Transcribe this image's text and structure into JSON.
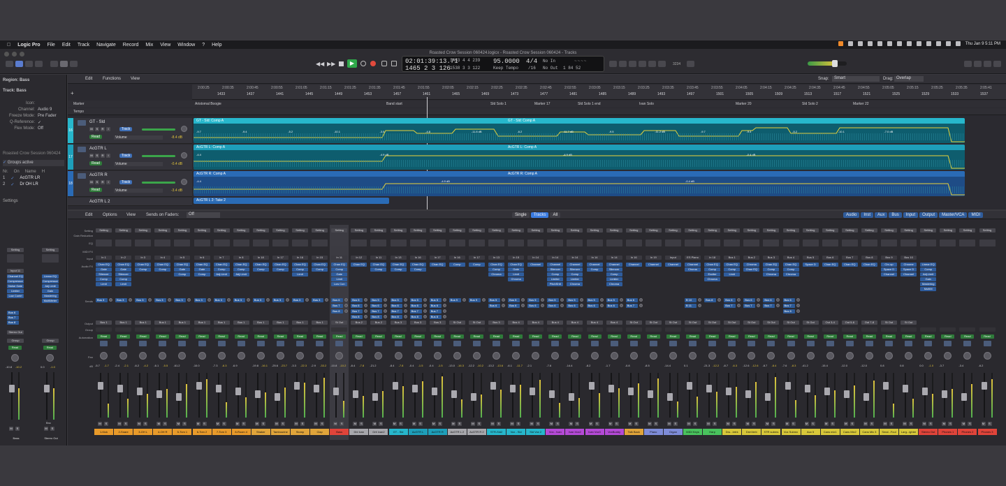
{
  "menubar": {
    "app": "Logic Pro",
    "items": [
      "File",
      "Edit",
      "Track",
      "Navigate",
      "Record",
      "Mix",
      "View",
      "Window",
      "?",
      "Help"
    ],
    "clock": "Thu Jan 9  5:11 PM"
  },
  "window_title": "Roasted Crow Session 060424.logicx - Roasted Crow Session 060424 - Tracks",
  "lcd": {
    "time": "02:01:39:13.71",
    "bars": "1465  2  3  126",
    "sub_time": "1433  4  4  239",
    "sub_bars": "1538  3  3  122",
    "tempo": "95.0000",
    "tempo_mode": "Keep Tempo",
    "signature": "4/4",
    "division": "/16",
    "in_label": "No In",
    "out_label": "No Out",
    "cpu": "1 84 52",
    "counter": "3234"
  },
  "inspector": {
    "region": "Region: Bass",
    "track": "Track: Bass",
    "rows": [
      {
        "k": "Icon:",
        "v": ""
      },
      {
        "k": "Channel:",
        "v": "Audio 9"
      },
      {
        "k": "Freeze Mode:",
        "v": "Pre Fader"
      },
      {
        "k": "Q-Reference:",
        "v": "✓"
      },
      {
        "k": "Flex Mode:",
        "v": "Off"
      }
    ],
    "session_label": "Roasted Crow Session 060424",
    "groups_active": "Groups active",
    "groups_head": [
      "Nr.",
      "On",
      "Name",
      "H"
    ],
    "groups": [
      {
        "nr": "1",
        "name": "AcGTR LR"
      },
      {
        "nr": "2",
        "name": "Dr OH LR"
      }
    ],
    "settings": "Settings",
    "strip1": {
      "setting": "Setting",
      "input": "Input 11",
      "plugins": [
        "Channel EQ",
        "Compressor",
        "Noise Gate",
        "Limiter",
        "Low Contrl"
      ],
      "sends": [
        "Bus 6",
        "Bus 7",
        "Bus 8"
      ],
      "output": "Stereo Out",
      "group": "Group",
      "auto": "Read",
      "db_left": "-10.8",
      "db_right": "-10.2",
      "name": "Bass"
    },
    "strip2": {
      "setting": "Setting",
      "plugins": [
        "Linear EQ",
        "Compressor",
        "Adj.Limit",
        "Gain",
        "Mastering",
        "MultiMeter"
      ],
      "group": "Group",
      "auto": "Read",
      "db_left": "0.0",
      "db_right": "-1.0",
      "bnc": "Bnc",
      "name": "Stereo Out"
    }
  },
  "tracks_toolbar": {
    "edit": "Edit",
    "functions": "Functions",
    "view": "View",
    "snap_label": "Snap:",
    "snap": "Smart",
    "drag_label": "Drag:",
    "drag": "Overlap"
  },
  "ruler": {
    "times": [
      "2:00:25",
      "2:00:35",
      "2:00:45",
      "2:00:55",
      "2:01:05",
      "2:01:15",
      "2:01:25",
      "2:01:35",
      "2:01:45",
      "2:01:55",
      "2:02:05",
      "2:02:15",
      "2:02:25",
      "2:02:35",
      "2:02:45",
      "2:02:55",
      "2:03:05",
      "2:03:15",
      "2:03:25",
      "2:03:35",
      "2:03:45",
      "2:03:55",
      "2:04:05",
      "2:04:15",
      "2:04:25",
      "2:04:35",
      "2:04:45",
      "2:04:55",
      "2:05:05",
      "2:05:15",
      "2:05:25",
      "2:05:35",
      "2:05:41"
    ],
    "bars": [
      "1433",
      "1437",
      "1441",
      "1445",
      "1449",
      "1453",
      "1457",
      "1461",
      "1465",
      "1469",
      "1473",
      "1477",
      "1481",
      "1485",
      "1489",
      "1493",
      "1497",
      "1501",
      "1505",
      "1509",
      "1513",
      "1517",
      "1521",
      "1525",
      "1529",
      "1533",
      "1537"
    ]
  },
  "marker_label": "Marker",
  "tempo_label": "Tempo",
  "markers": [
    "Aristomal Boogie",
    "Band start",
    "Sld Solo 1",
    "Marker 17",
    "Sld Solo 1 end",
    "Ivan Solo",
    "Marker 20",
    "Sld Solo 2",
    "Marker 22"
  ],
  "tracks": [
    {
      "num": "16",
      "name": "GT - Sld",
      "mode": "Read",
      "param": "Volume",
      "db": "-8.4 dB",
      "region": "GT - Sld: Comp A",
      "region2": "GT - Sld: Comp A",
      "color": "#27b7cc"
    },
    {
      "num": "17",
      "name": "AcGTR L",
      "mode": "Read",
      "param": "Volume",
      "db": "-0.4 dB",
      "region": "AcGTR L: Comp A",
      "region2": "AcGTR L: Comp A",
      "color": "#1e9fba"
    },
    {
      "num": "18",
      "name": "AcGTR R",
      "mode": "Read",
      "param": "Volume",
      "db": "-3.4 dB",
      "region": "AcGTR R: Comp A",
      "region2": "AcGTR R: Comp A",
      "color": "#2a6bb6"
    },
    {
      "num": "19",
      "name": "AcGTR L 2",
      "region": "AcGTR L 2: Take 2"
    }
  ],
  "automation_values": [
    [
      "-9.7",
      "-9.4",
      "-5.2",
      "-10.1",
      "-3.5",
      "-4.8",
      "-11.8 dB",
      "-6.2",
      "-11.7 dB",
      "-9.5",
      "-11.2 dB",
      "-9.7",
      "-9.4",
      "-5.2",
      "-10.1",
      "-7.0 dB"
    ],
    [
      "-4.4",
      "-4.9 dB",
      "-4.9 dB",
      "-0.4 dB"
    ],
    [
      "-4.4",
      "-4.9 dB",
      "-0.4 dB"
    ]
  ],
  "mixer_toolbar": {
    "edit": "Edit",
    "options": "Options",
    "view": "View",
    "sends_on_faders": "Sends on Faders:",
    "sends_value": "Off",
    "filter": [
      "Single",
      "Tracks",
      "All"
    ],
    "types": [
      "Audio",
      "Inst",
      "Aux",
      "Bus",
      "Input",
      "Output",
      "Master/VCA",
      "MIDI"
    ]
  },
  "row_labels": [
    "Setting",
    "Gain Reduction",
    "EQ",
    "MIDI FX",
    "Input",
    "Audio FX",
    "Sends",
    "Output",
    "Group",
    "Automation",
    "Pan",
    "dB"
  ],
  "strips": [
    {
      "name": "1-Kick",
      "color": "#e89a2a",
      "input": "In 1",
      "fx": [
        "Chan EQ",
        "Gate",
        "Silencer",
        "Comp",
        "Limit"
      ],
      "sends": [
        "Bus 3"
      ],
      "out": "Bus 1",
      "db": "-5.7",
      "db2": "-1.7",
      "auto": "Read"
    },
    {
      "name": "2-Snare",
      "color": "#e89a2a",
      "input": "In 2",
      "fx": [
        "Chan EQ",
        "Gate",
        "Silencer",
        "Comp",
        "Limit"
      ],
      "sends": [
        "Bus 3"
      ],
      "out": "Bus 1",
      "db": "-2.4",
      "db2": "-2.1",
      "auto": "Read"
    },
    {
      "name": "3-OH L",
      "color": "#e89a2a",
      "input": "In 3",
      "fx": [
        "Chan EQ",
        "Comp"
      ],
      "sends": [
        "Bus 3"
      ],
      "out": "Bus 1",
      "db": "-6.2",
      "db2": "-4.2",
      "auto": "Read"
    },
    {
      "name": "4-OH R",
      "color": "#e89a2a",
      "input": "In 4",
      "fx": [
        "Chan EQ",
        "Comp"
      ],
      "sends": [
        "Bus 3"
      ],
      "out": "Bus 1",
      "db": "-6.1",
      "db2": "-5.5",
      "auto": "Read"
    },
    {
      "name": "5-Tom 1",
      "color": "#e89a2a",
      "input": "In 5",
      "fx": [
        "Chan EQ",
        "Gate",
        "Comp"
      ],
      "sends": [
        "Bus 3"
      ],
      "out": "Bus 1",
      "db": "-61.2",
      "db2": "",
      "auto": "Read"
    },
    {
      "name": "6-Tom 2",
      "color": "#e89a2a",
      "input": "In 6",
      "fx": [
        "Chan EQ",
        "Gate",
        "Comp"
      ],
      "sends": [
        "Bus 3"
      ],
      "out": "Bus 1",
      "db": "-10.0",
      "db2": "",
      "auto": "Read"
    },
    {
      "name": "7-Tom 3",
      "color": "#e89a2a",
      "input": "In 7",
      "fx": [
        "Chan EQ",
        "Comp",
        "Adj.Limit"
      ],
      "sends": [
        "Bus 3"
      ],
      "out": "Bus 1",
      "db": "-7.3",
      "db2": "-6.3",
      "auto": "Read"
    },
    {
      "name": "8-Room 4",
      "color": "#e89a2a",
      "input": "In 8",
      "fx": [
        "Chan EQ",
        "Comp",
        "Adj.Limit"
      ],
      "sends": [
        "Bus 3"
      ],
      "out": "Bus 1",
      "db": "-6.9",
      "db2": "",
      "auto": "Read"
    },
    {
      "name": "Shaker",
      "color": "#e0a43a",
      "input": "In 18",
      "fx": [
        "Chan EQ",
        "Comp"
      ],
      "sends": [
        "Bus 3"
      ],
      "out": "Bus 1",
      "db": "-19.8",
      "db2": "-16.1",
      "auto": "Read"
    },
    {
      "name": "Tambourine",
      "color": "#e0a43a",
      "input": "In 17",
      "fx": [
        "Chan EQ",
        "Comp"
      ],
      "sends": [
        "Bus 3"
      ],
      "out": "Bus 1",
      "db": "-25.6",
      "db2": "-23.7",
      "auto": "Read"
    },
    {
      "name": "Stomp",
      "color": "#e0a43a",
      "input": "In 16",
      "fx": [
        "Chan EQ",
        "Comp",
        "Limit"
      ],
      "sends": [
        "Bus 3"
      ],
      "out": "Bus 1",
      "db": "-3.3",
      "db2": "-22.3",
      "auto": "Read"
    },
    {
      "name": "Clap",
      "color": "#e0a43a",
      "input": "In 15",
      "fx": [
        "Chan EQ",
        "Comp"
      ],
      "sends": [
        "Bus 3"
      ],
      "out": "Bus 1",
      "db": "-2.9",
      "db2": "-33.2",
      "auto": "Read"
    },
    {
      "name": "Bass",
      "color": "#e0443a",
      "input": "In 11",
      "fx": [
        "Chan EQ",
        "Comp",
        "Gate",
        "Limit",
        "Low Con"
      ],
      "sends": [
        "Bus 6",
        "Bus 7",
        "Bus 8"
      ],
      "out": "St Out",
      "db": "-10.8",
      "db2": "-10.2",
      "auto": "Read"
    },
    {
      "name": "Dbl Ivan",
      "color": "#a7a7ac",
      "input": "In 12",
      "fx": [
        "Chan EQ"
      ],
      "sends": [
        "Bus 5",
        "Bus 6",
        "Bus 7",
        "Bus 8"
      ],
      "out": "Bus 2",
      "db": "-8.4",
      "db2": "-7.8",
      "auto": "Read"
    },
    {
      "name": "Grit Ivan2",
      "color": "#a7a7ac",
      "input": "In 11",
      "fx": [
        "Chan EQ",
        "Comp"
      ],
      "sends": [
        "Bus 5",
        "Bus 6",
        "Bus 7",
        "Bus 8"
      ],
      "out": "Bus 2",
      "db": "-21.2",
      "db2": "",
      "auto": "Read"
    },
    {
      "name": "GT - Sld",
      "color": "#27b7cc",
      "input": "In 13",
      "fx": [
        "Chan EQ",
        "Comp"
      ],
      "sends": [
        "Bus 5",
        "Bus 6",
        "Bus 7",
        "Bus 8"
      ],
      "out": "Bus 3",
      "db": "-8.4",
      "db2": "-7.8",
      "auto": "Read"
    },
    {
      "name": "AcGTR L",
      "color": "#1e9fba",
      "input": "In 16",
      "fx": [
        "Chan EQ",
        "Comp"
      ],
      "sends": [
        "Bus 5",
        "Bus 6",
        "Bus 7",
        "Bus 8"
      ],
      "out": "Bus 3",
      "db": "-0.4",
      "db2": "-1.5",
      "auto": "Read"
    },
    {
      "name": "AcGTR R",
      "color": "#1e9fba",
      "input": "In 17",
      "fx": [
        "Chan EQ"
      ],
      "sends": [
        "Bus 5",
        "Bus 6",
        "Bus 7",
        "Bus 8"
      ],
      "out": "Bus 3",
      "db": "-0.4",
      "db2": "-1.5",
      "auto": "Read"
    },
    {
      "name": "AcGTR L 2",
      "color": "#a7a7ac",
      "input": "In 16",
      "fx": [
        "Comp"
      ],
      "sends": [
        "Bus 9"
      ],
      "out": "St Out",
      "db": "-13.0",
      "db2": "-16.3",
      "auto": "Read"
    },
    {
      "name": "AcGTR R 2",
      "color": "#a7a7ac",
      "input": "In 17",
      "fx": [
        "Comp"
      ],
      "sends": [
        "Bus 9"
      ],
      "out": "St Out",
      "db": "-12.2",
      "db2": "-10.2",
      "auto": "Read"
    },
    {
      "name": "STR-Sld2",
      "color": "#27b7cc",
      "input": "In 13",
      "fx": [
        "Chan EQ",
        "Comp",
        "Chroma"
      ],
      "sends": [
        "Bus 5",
        "Bus 6"
      ],
      "out": "Bus 3",
      "db": "-13.2",
      "db2": "-13.6",
      "auto": "Read"
    },
    {
      "name": "Vox - Sld",
      "color": "#27b7cc",
      "input": "In 15",
      "fx": [
        "Chan EQ",
        "Gate",
        "Limit",
        "Chroma"
      ],
      "sends": [
        "Bus 5",
        "Bus 6"
      ],
      "out": "Bus 4",
      "db": "-6.1",
      "db2": "-11.7",
      "auto": "Read"
    },
    {
      "name": "Sld Vox 2",
      "color": "#27b7cc",
      "input": "In 14",
      "fx": [
        "Channel"
      ],
      "sends": [
        "Bus 5",
        "Bus 6"
      ],
      "out": "Bus 4",
      "db": "-2.1",
      "db2": "",
      "auto": "Read"
    },
    {
      "name": "Vox - Ivan",
      "color": "#b44ad6",
      "input": "In 14",
      "fx": [
        "Channel",
        "Silencer",
        "Comp",
        "Limiter",
        "PitchShft"
      ],
      "sends": [
        "Bus 5",
        "Bus 6"
      ],
      "out": "Bus 4",
      "db": "-7.6",
      "db2": "",
      "auto": "Read"
    },
    {
      "name": "Ivan Vox2",
      "color": "#b44ad6",
      "input": "In 14",
      "fx": [
        "Channel",
        "Silencer",
        "Comp",
        "Limiter",
        "Chroma"
      ],
      "sends": [
        "Bus 5",
        "Bus 6"
      ],
      "out": "Bus 4",
      "db": "-14.4",
      "db2": "",
      "auto": "Read"
    },
    {
      "name": "Ivan Vox3",
      "color": "#b44ad6",
      "input": "In 14",
      "fx": [
        "Channel",
        "Comp"
      ],
      "sends": [
        "Bus 5",
        "Bus 6"
      ],
      "out": "Bus 4",
      "db": "-8.2",
      "db2": "",
      "auto": "Read"
    },
    {
      "name": "VoxBuddy",
      "color": "#b44ad6",
      "input": "In 14",
      "fx": [
        "Channel",
        "Silencer",
        "Comp",
        "Limiter",
        "Chroma"
      ],
      "sends": [
        "Bus 5",
        "Bus 6"
      ],
      "out": "Bus 4",
      "db": "-1.7",
      "db2": "",
      "auto": "Read"
    },
    {
      "name": "Talk Back",
      "color": "#e0a43a",
      "input": "In 16",
      "fx": [
        "Channel"
      ],
      "sends": [
        "Bus 6",
        "Bus 7"
      ],
      "out": "St Out",
      "db": "-0.8",
      "db2": "",
      "auto": "Read"
    },
    {
      "name": "Piano",
      "color": "#7e8cd8",
      "input": "In 19",
      "fx": [
        "Channel"
      ],
      "sends": [],
      "out": "St Out",
      "db": "-8.5",
      "db2": "",
      "auto": "Read"
    },
    {
      "name": "Organ",
      "color": "#7e8cd8",
      "input": "Input",
      "fx": [
        "Channel"
      ],
      "sends": [],
      "out": "St Out",
      "db": "-14.4",
      "db2": "",
      "auto": "Read"
    },
    {
      "name": "MIDI Keys",
      "color": "#49c25d",
      "input": "ES Piano",
      "fx": [
        "Channel",
        "Chorus"
      ],
      "sends": [
        "B 10",
        "B 11"
      ],
      "out": "St Out",
      "db": "0.1",
      "db2": "",
      "auto": "Read"
    },
    {
      "name": "Harp",
      "color": "#49c25d",
      "input": "In 18",
      "fx": [
        "Chan EQ",
        "Comp",
        "Exciter",
        "Chroma"
      ],
      "sends": [
        "Bus 8"
      ],
      "out": "St Out",
      "db": "-21.3",
      "db2": "-12.2",
      "auto": "Read"
    },
    {
      "name": "Dru...brtrk",
      "color": "#d8c83a",
      "input": "Bus 1",
      "fx": [
        "Chan EQ",
        "Comp",
        "Limit"
      ],
      "sends": [
        "Bus 6",
        "Bus 7"
      ],
      "out": "St Out",
      "db": "-8.7",
      "db2": "-6.3",
      "auto": "Read"
    },
    {
      "name": "DrmVerb",
      "color": "#d8c83a",
      "input": "Bus 2",
      "fx": [
        "Chroma",
        "Chan EQ"
      ],
      "sends": [
        "Bus 6",
        "Bus 7"
      ],
      "out": "St Out",
      "db": "-12.6",
      "db2": "-12.6",
      "auto": "Read"
    },
    {
      "name": "STR subms",
      "color": "#d8c83a",
      "input": "Bus 3",
      "fx": [
        "Chan EQ",
        "Comp",
        "Chroma"
      ],
      "sends": [
        "Bus 6",
        "Bus 7"
      ],
      "out": "St Out",
      "db": "-8.7",
      "db2": "-8.4",
      "auto": "Read"
    },
    {
      "name": "Vox Submx",
      "color": "#d8c83a",
      "input": "Bus 4",
      "fx": [
        "Chan EQ",
        "Comp",
        "Chroma"
      ],
      "sends": [
        "Bus 6",
        "Bus 7",
        "Bus 8"
      ],
      "out": "St Out",
      "db": "-7.6",
      "db2": "-8.3",
      "auto": "Read"
    },
    {
      "name": "Aux 5",
      "color": "#d8c83a",
      "input": "Bus 5",
      "fx": [
        "Space D"
      ],
      "sends": [],
      "out": "St Out",
      "db": "-41.2",
      "db2": "",
      "auto": "Read"
    },
    {
      "name": "Cans mix1",
      "color": "#d8c83a",
      "input": "Bus 6",
      "fx": [
        "Chan EQ"
      ],
      "sends": [],
      "out": "Out 3-4",
      "db": "-15.4",
      "db2": "",
      "auto": "Read"
    },
    {
      "name": "Cans Mix2",
      "color": "#d8c83a",
      "input": "Bus 7",
      "fx": [
        "Chan EQ"
      ],
      "sends": [],
      "out": "Out 5-6",
      "db": "-12.0",
      "db2": "",
      "auto": "Read"
    },
    {
      "name": "Cans Mix 3",
      "color": "#d8c83a",
      "input": "Bus 8",
      "fx": [
        "Chan EQ"
      ],
      "sends": [],
      "out": "Out 7-8",
      "db": "-12.0",
      "db2": "",
      "auto": "Read"
    },
    {
      "name": "Smal...Foul",
      "color": "#d8c83a",
      "input": "Bus 9",
      "fx": [
        "Chr-op",
        "Space D",
        "Channel"
      ],
      "sends": [],
      "out": "St Out",
      "db": "0.8",
      "db2": "",
      "auto": "Read"
    },
    {
      "name": "Larg...ighter",
      "color": "#d8c83a",
      "input": "Bus 10",
      "fx": [
        "Chrome",
        "Space D",
        "Channel"
      ],
      "sends": [],
      "out": "St Out",
      "db": "0.8",
      "db2": "",
      "auto": "Read"
    },
    {
      "name": "Stereo Out",
      "color": "#e0443a",
      "input": "",
      "fx": [
        "Linear EQ",
        "Comp",
        "Adj.Limit",
        "Gain",
        "Mastering",
        "MultiM"
      ],
      "sends": [],
      "out": "",
      "db": "0.0",
      "db2": "-1.0",
      "auto": "Read"
    },
    {
      "name": "Phones 1",
      "color": "#e0443a",
      "input": "",
      "fx": [],
      "sends": [],
      "out": "",
      "db": "-3.7",
      "db2": "",
      "auto": "Read"
    },
    {
      "name": "Phones 2",
      "color": "#e0443a",
      "input": "",
      "fx": [],
      "sends": [],
      "out": "",
      "db": "-3.4",
      "db2": "",
      "auto": "Read"
    },
    {
      "name": "Phones 3",
      "color": "#e0443a",
      "input": "",
      "fx": [],
      "sends": [],
      "out": "",
      "db": "-6.2",
      "db2": "",
      "auto": "Read"
    }
  ],
  "bnc_label": "Bnc",
  "colors": {
    "accent": "#3a7be0",
    "region_teal": "#1d9eb8",
    "region_blue": "#2a6bb6",
    "read_green": "#2f7a3a"
  }
}
